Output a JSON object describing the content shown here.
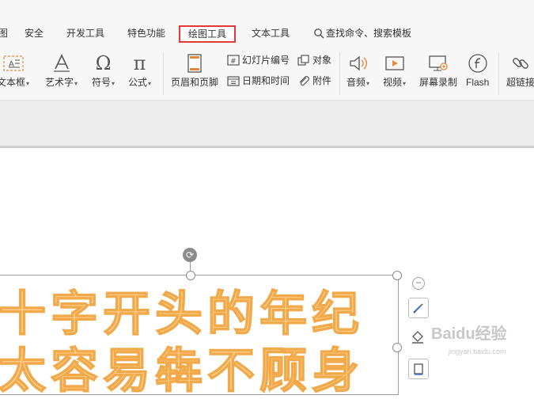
{
  "tabs": [
    {
      "label": "图"
    },
    {
      "label": "安全"
    },
    {
      "label": "开发工具"
    },
    {
      "label": "特色功能"
    },
    {
      "label": "绘图工具"
    },
    {
      "label": "文本工具"
    }
  ],
  "search": {
    "label": "查找命令、搜索模板"
  },
  "ribbon": {
    "textbox": "文本框",
    "wordart": "艺术字",
    "symbol": "符号",
    "formula": "公式",
    "header_footer": "页眉和页脚",
    "slide_number": "幻灯片编号",
    "date_time": "日期和时间",
    "object": "对象",
    "attachment": "附件",
    "audio": "音频",
    "video": "视频",
    "screen_record": "屏幕录制",
    "flash": "Flash",
    "hyperlink": "超链接"
  },
  "slide": {
    "line1": "十字开头的年纪",
    "line2": "太容易犇不顾身"
  },
  "watermark": {
    "brand": "Baidu经验",
    "url": "jingyan.baidu.com"
  },
  "colors": {
    "accent_red": "#e53935",
    "text_fill": "#ffd49a",
    "text_stroke": "#f2a94a"
  }
}
